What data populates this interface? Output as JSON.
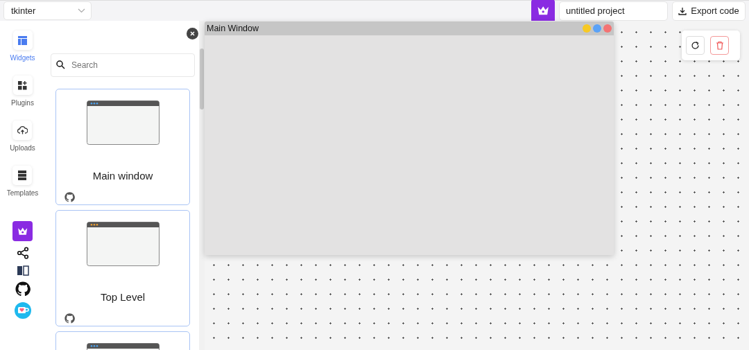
{
  "framework_select": {
    "value": "tkinter"
  },
  "project_name": {
    "value": "untitled project"
  },
  "export_button": {
    "label": "Export code"
  },
  "sidebar": {
    "items": [
      {
        "kind": "widgets",
        "label": "Widgets",
        "selected": true
      },
      {
        "kind": "plugins",
        "label": "Plugins",
        "selected": false
      },
      {
        "kind": "uploads",
        "label": "Uploads",
        "selected": false
      },
      {
        "kind": "templates",
        "label": "Templates",
        "selected": false
      }
    ],
    "links": [
      {
        "kind": "crown"
      },
      {
        "kind": "share"
      },
      {
        "kind": "book"
      },
      {
        "kind": "github"
      },
      {
        "kind": "coffee"
      }
    ]
  },
  "search": {
    "placeholder": "Search"
  },
  "widgets": [
    {
      "label": "Main window",
      "color": "#4aa3f0"
    },
    {
      "label": "Top Level",
      "color": "#f0a030"
    },
    {
      "color": "#4aa3f0"
    }
  ],
  "canvas_window": {
    "title": "Main Window"
  }
}
